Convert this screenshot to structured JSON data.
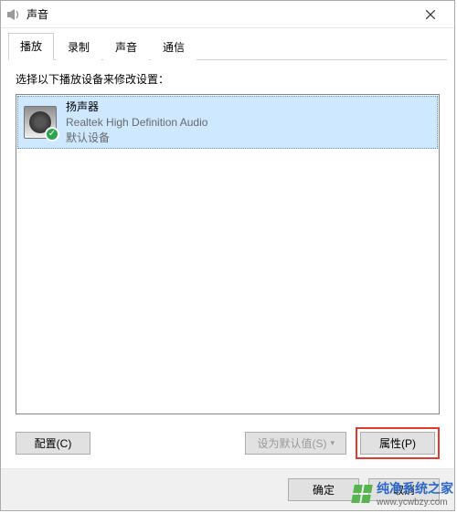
{
  "window": {
    "title": "声音",
    "close_label": "×"
  },
  "tabs": [
    {
      "label": "播放",
      "active": true
    },
    {
      "label": "录制",
      "active": false
    },
    {
      "label": "声音",
      "active": false
    },
    {
      "label": "通信",
      "active": false
    }
  ],
  "instruction": "选择以下播放设备来修改设置：",
  "device": {
    "name": "扬声器",
    "description": "Realtek High Definition Audio",
    "status": "默认设备",
    "checkmark": "✓"
  },
  "buttons": {
    "configure": "配置(C)",
    "set_default": "设为默认值(S)",
    "set_default_caret": "▾",
    "properties": "属性(P)"
  },
  "footer": {
    "ok": "确定",
    "cancel": "取消"
  },
  "watermark": {
    "text": "纯净系统之家",
    "host": "www.ycwbzy.com"
  }
}
